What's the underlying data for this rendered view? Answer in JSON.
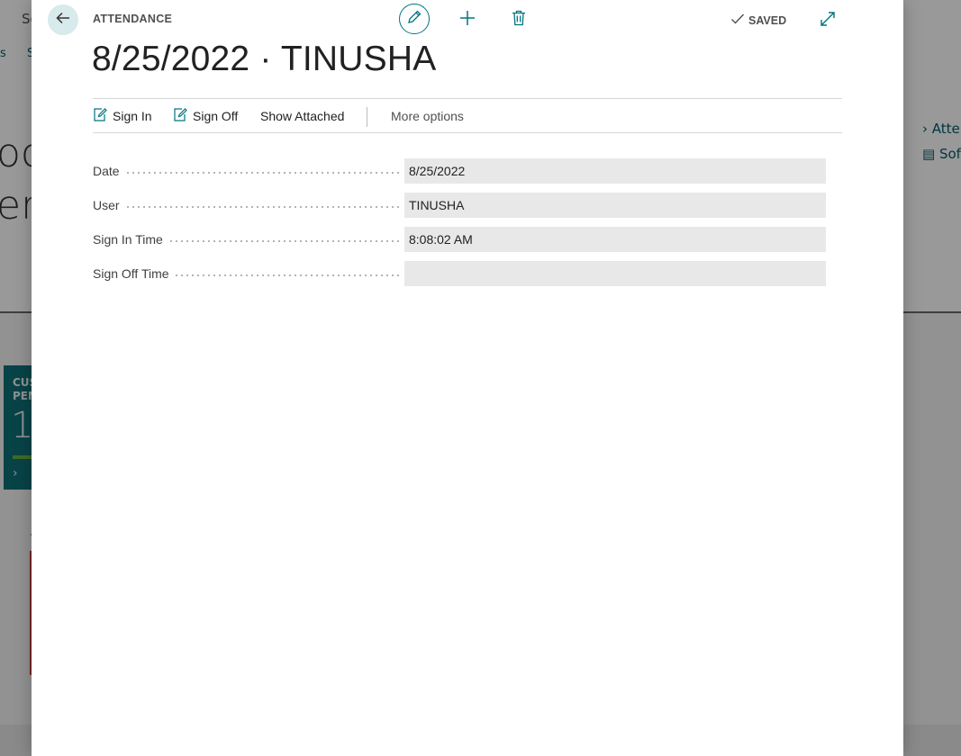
{
  "background": {
    "search_fragment": "Se",
    "nav_fragment_1": "s",
    "nav_fragment_2": "S",
    "headline_line1": "oo",
    "headline_line2": "era",
    "tile": {
      "title_line1": "CUS",
      "title_line2": "PEN",
      "value": "1"
    },
    "side_label": "A",
    "right_links": [
      "Atte",
      "Sof"
    ]
  },
  "header": {
    "caption": "ATTENDANCE",
    "saved_label": "SAVED"
  },
  "title": "8/25/2022 · TINUSHA",
  "actions": {
    "sign_in": "Sign In",
    "sign_off": "Sign Off",
    "show_attached": "Show Attached",
    "more_options": "More options"
  },
  "fields": [
    {
      "label": "Date",
      "value": "8/25/2022"
    },
    {
      "label": "User",
      "value": "TINUSHA"
    },
    {
      "label": "Sign In Time",
      "value": "8:08:02 AM"
    },
    {
      "label": "Sign Off Time",
      "value": ""
    }
  ],
  "colors": {
    "accent": "#00737e",
    "field_bg": "#e8e8e8"
  },
  "icons": {
    "back": "arrow-left-icon",
    "edit": "pencil-icon",
    "add": "plus-icon",
    "delete": "trash-icon",
    "saved": "checkmark-icon",
    "expand": "expand-icon",
    "sign_in": "edit-document-icon",
    "sign_off": "edit-document-icon"
  }
}
